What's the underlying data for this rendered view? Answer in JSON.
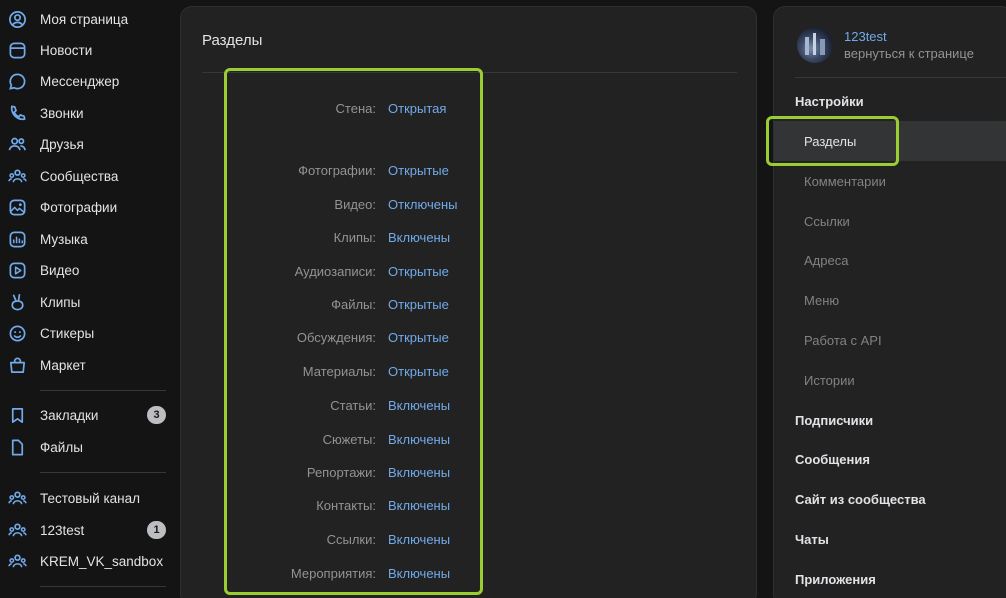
{
  "left_nav": {
    "items": [
      {
        "label": "Моя страница",
        "icon": "user-circle-icon"
      },
      {
        "label": "Новости",
        "icon": "news-icon"
      },
      {
        "label": "Мессенджер",
        "icon": "message-icon"
      },
      {
        "label": "Звонки",
        "icon": "phone-icon"
      },
      {
        "label": "Друзья",
        "icon": "friends-icon"
      },
      {
        "label": "Сообщества",
        "icon": "communities-icon"
      },
      {
        "label": "Фотографии",
        "icon": "photo-icon"
      },
      {
        "label": "Музыка",
        "icon": "music-icon"
      },
      {
        "label": "Видео",
        "icon": "video-icon"
      },
      {
        "label": "Клипы",
        "icon": "clips-icon"
      },
      {
        "label": "Стикеры",
        "icon": "sticker-icon"
      },
      {
        "label": "Маркет",
        "icon": "market-bag-icon"
      }
    ],
    "secondary": [
      {
        "label": "Закладки",
        "icon": "bookmark-icon",
        "badge": "3"
      },
      {
        "label": "Файлы",
        "icon": "file-icon"
      }
    ],
    "groups": [
      {
        "label": "Тестовый канал",
        "icon": "group-icon"
      },
      {
        "label": "123test",
        "icon": "group-icon",
        "badge": "1"
      },
      {
        "label": "KREM_VK_sandbox",
        "icon": "group-icon"
      }
    ]
  },
  "main": {
    "title": "Разделы",
    "rows": [
      {
        "label": "Стена:",
        "value": "Открытая"
      },
      {
        "label": "Фотографии:",
        "value": "Открытые"
      },
      {
        "label": "Видео:",
        "value": "Отключены"
      },
      {
        "label": "Клипы:",
        "value": "Включены"
      },
      {
        "label": "Аудиозаписи:",
        "value": "Открытые"
      },
      {
        "label": "Файлы:",
        "value": "Открытые"
      },
      {
        "label": "Обсуждения:",
        "value": "Открытые"
      },
      {
        "label": "Материалы:",
        "value": "Открытые"
      },
      {
        "label": "Статьи:",
        "value": "Включены"
      },
      {
        "label": "Сюжеты:",
        "value": "Включены"
      },
      {
        "label": "Репортажи:",
        "value": "Включены"
      },
      {
        "label": "Контакты:",
        "value": "Включены"
      },
      {
        "label": "Ссылки:",
        "value": "Включены"
      },
      {
        "label": "Мероприятия:",
        "value": "Включены"
      }
    ]
  },
  "right": {
    "profile_name": "123test",
    "profile_back": "вернуться к странице",
    "settings": "Настройки",
    "sub_items": [
      "Разделы",
      "Комментарии",
      "Ссылки",
      "Адреса",
      "Меню",
      "Работа с API",
      "Истории"
    ],
    "heads": [
      "Подписчики",
      "Сообщения",
      "Сайт из сообщества",
      "Чаты",
      "Приложения"
    ]
  },
  "colors": {
    "accent_link": "#71aaeb",
    "highlight": "#9acd32",
    "background": "#141414",
    "card": "#222222"
  }
}
